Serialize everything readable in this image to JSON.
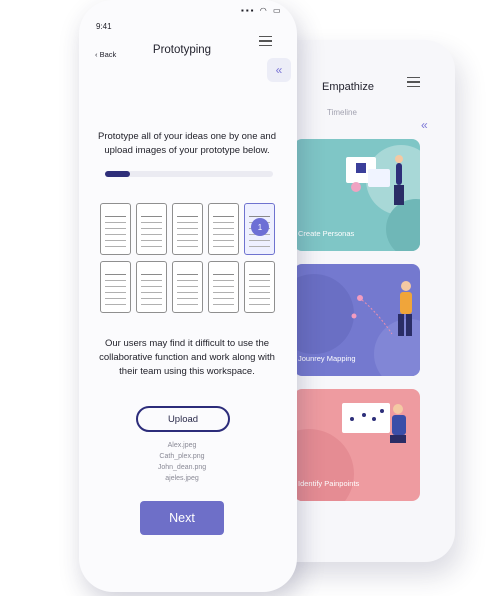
{
  "front": {
    "status_time": "9:41",
    "back_label": "‹ Back",
    "title": "Prototyping",
    "tab_chevron": "«",
    "prompt_text": "Prototype all of your ideas one by one and upload images of your prototype below.",
    "progress": 0.15,
    "gallery_badge": "1",
    "note_text": "Our users may find it difficult to use the collaborative function and work along with their team using this workspace.",
    "upload_label": "Upload",
    "files": [
      "Alex.jpeg",
      "Cath_plex.png",
      "John_dean.png",
      "ajeles.jpeg"
    ],
    "next_label": "Next"
  },
  "back": {
    "title": "Empathize",
    "subtitle": "Timeline",
    "chevron": "«",
    "cards": [
      {
        "label": "Create Personas",
        "color": "#7fc6c6"
      },
      {
        "label": "Jounrey Mapping",
        "color": "#7479cf"
      },
      {
        "label": "Identify Painpoints",
        "color": "#ee9ba0"
      }
    ]
  },
  "colors": {
    "accent": "#6e6fc8",
    "dark_accent": "#2c2c7a"
  }
}
